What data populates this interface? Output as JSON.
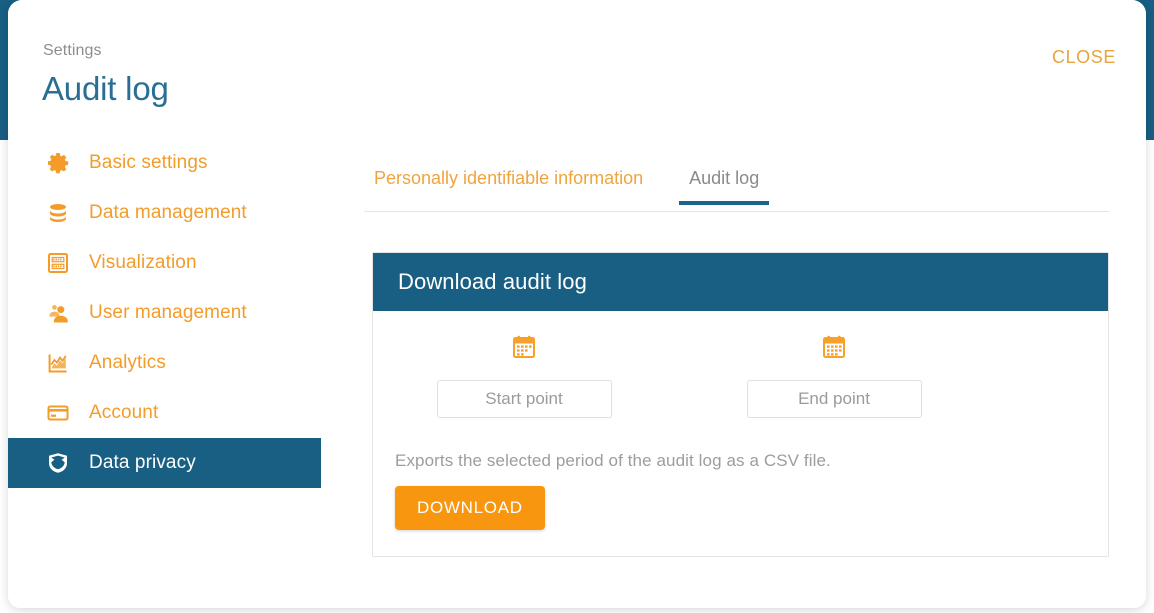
{
  "header": {
    "breadcrumb": "Settings",
    "title": "Audit log",
    "close_label": "CLOSE"
  },
  "sidebar": {
    "items": [
      {
        "label": "Basic settings",
        "icon": "gear-icon",
        "active": false
      },
      {
        "label": "Data management",
        "icon": "database-icon",
        "active": false
      },
      {
        "label": "Visualization",
        "icon": "table-grid-icon",
        "active": false
      },
      {
        "label": "User management",
        "icon": "user-icon",
        "active": false
      },
      {
        "label": "Analytics",
        "icon": "chart-icon",
        "active": false
      },
      {
        "label": "Account",
        "icon": "credit-card-icon",
        "active": false
      },
      {
        "label": "Data privacy",
        "icon": "shield-icon",
        "active": true
      }
    ]
  },
  "tabs": [
    {
      "label": "Personally identifiable information",
      "active": false
    },
    {
      "label": "Audit log",
      "active": true
    }
  ],
  "card": {
    "title": "Download audit log",
    "start_point": {
      "placeholder": "Start point",
      "value": "",
      "icon": "calendar-icon"
    },
    "end_point": {
      "placeholder": "End point",
      "value": "",
      "icon": "calendar-icon"
    },
    "note": "Exports the selected period of the audit log as a CSV file.",
    "download_label": "DOWNLOAD"
  },
  "colors": {
    "brand_blue": "#185f83",
    "accent_orange": "#f39c2a",
    "button_orange": "#f8970f",
    "title_blue": "#2a6f92",
    "muted_text": "#9b9b9b"
  }
}
